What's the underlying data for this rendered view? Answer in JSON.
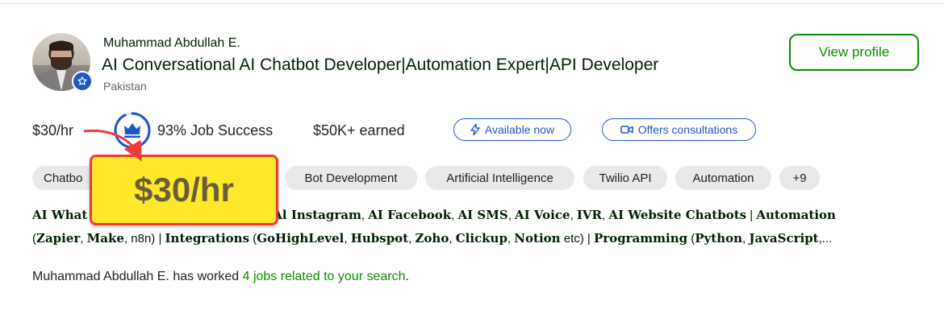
{
  "freelancer": {
    "name": "Muhammad Abdullah E.",
    "title": "AI Conversational AI Chatbot Developer|Automation Expert|API Developer",
    "country": "Pakistan",
    "view_profile_label": "View profile"
  },
  "stats": {
    "rate": "$30/hr",
    "job_success": "93% Job Success",
    "job_success_percent": 93,
    "earned": "$50K+ earned"
  },
  "badges": {
    "available": "Available now",
    "consultations": "Offers consultations"
  },
  "skills": [
    "Chatbo",
    "Bot Development",
    "Artificial Intelligence",
    "Twilio API",
    "Automation",
    "+9"
  ],
  "bio": {
    "line1": [
      {
        "t": "AI What",
        "b": true
      },
      {
        "t": "Al Instagram",
        "b": true
      },
      {
        "t": ", ",
        "b": false
      },
      {
        "t": "AI Facebook",
        "b": true
      },
      {
        "t": ", ",
        "b": false
      },
      {
        "t": "AI SMS",
        "b": true
      },
      {
        "t": ", ",
        "b": false
      },
      {
        "t": "AI Voice",
        "b": true
      },
      {
        "t": ", ",
        "b": false
      },
      {
        "t": "IVR",
        "b": true
      },
      {
        "t": ", ",
        "b": false
      },
      {
        "t": "AI Website Chatbots",
        "b": true
      },
      {
        "t": " | ",
        "b": false
      },
      {
        "t": "Automation",
        "b": true
      }
    ],
    "line2": [
      {
        "t": "(",
        "b": false
      },
      {
        "t": "Zapier",
        "b": true
      },
      {
        "t": ", ",
        "b": false
      },
      {
        "t": "Make",
        "b": true
      },
      {
        "t": ", ",
        "b": false
      },
      {
        "t": "n8n",
        "b": false
      },
      {
        "t": ") | ",
        "b": false
      },
      {
        "t": "Integrations",
        "b": true
      },
      {
        "t": " (",
        "b": false
      },
      {
        "t": "GoHighLevel",
        "b": true
      },
      {
        "t": ", ",
        "b": false
      },
      {
        "t": "Hubspot",
        "b": true
      },
      {
        "t": ", ",
        "b": false
      },
      {
        "t": "Zoho",
        "b": true
      },
      {
        "t": ", ",
        "b": false
      },
      {
        "t": "Clickup",
        "b": true
      },
      {
        "t": ", ",
        "b": false
      },
      {
        "t": "Notion",
        "b": true
      },
      {
        "t": " etc) | ",
        "b": false
      },
      {
        "t": "Programming",
        "b": true
      },
      {
        "t": " (",
        "b": false
      },
      {
        "t": "Python",
        "b": true
      },
      {
        "t": ", ",
        "b": false
      },
      {
        "t": "JavaScript",
        "b": true
      },
      {
        "t": ",...",
        "b": false
      }
    ]
  },
  "worked": {
    "prefix": "Muhammad Abdullah E. has worked",
    "link": "4 jobs related to your search",
    "suffix": "."
  },
  "callout": {
    "text": "$30/hr",
    "fill_color": "#fde82c",
    "border_color": "#ee3b3b"
  },
  "colors": {
    "brand_green": "#108a00",
    "accent_blue": "#1f57c3"
  }
}
